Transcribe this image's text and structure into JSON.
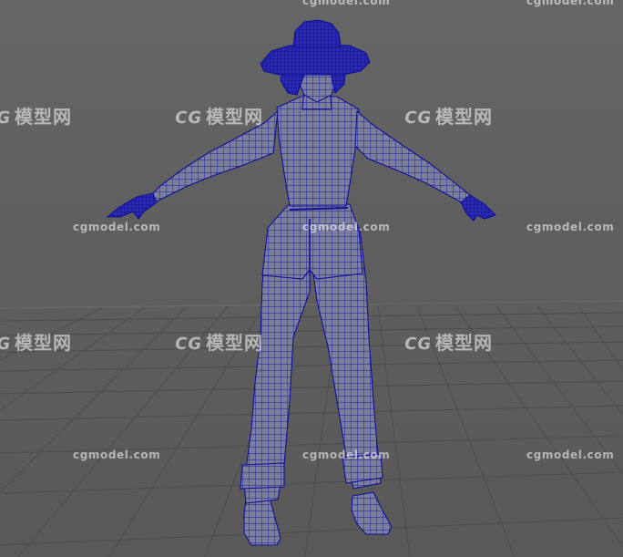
{
  "viewport": {
    "background": "#5f5f5f",
    "grid_color": "#4e4e4e",
    "wireframe_color": "#1414a8"
  },
  "watermark": {
    "url_text": "cgmodel.com",
    "logo_mark": "CG",
    "logo_text": "模型网"
  }
}
